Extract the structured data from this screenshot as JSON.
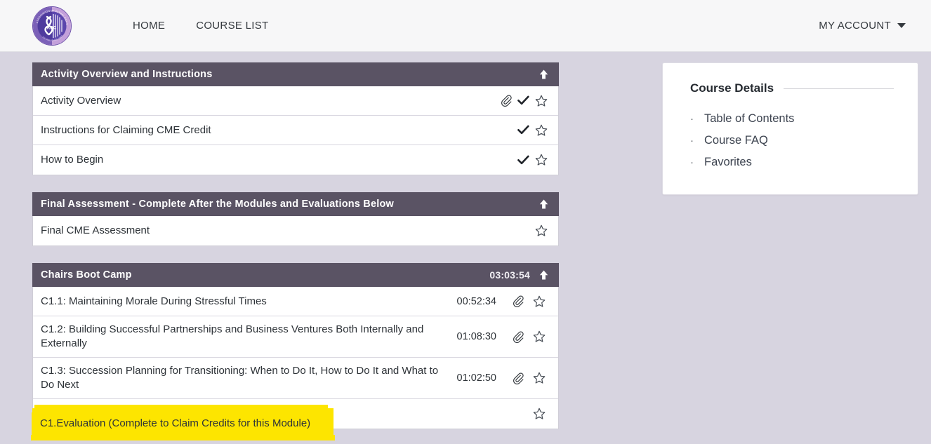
{
  "navbar": {
    "logo_alt": "Association of Pathology Chairs",
    "logo_center_text": "APC",
    "links": [
      {
        "label": "HOME",
        "name": "nav-link-home"
      },
      {
        "label": "COURSE LIST",
        "name": "nav-link-course-list"
      }
    ],
    "account_label": "MY ACCOUNT"
  },
  "sections": [
    {
      "title": "Activity Overview and Instructions",
      "duration": "",
      "collapse_icon": "arrow-up-icon",
      "rows": [
        {
          "title": "Activity Overview",
          "time": "",
          "attachment": true,
          "complete": true,
          "favorite": false
        },
        {
          "title": "Instructions for Claiming CME Credit",
          "time": "",
          "attachment": false,
          "complete": true,
          "favorite": false
        },
        {
          "title": "How to Begin",
          "time": "",
          "attachment": false,
          "complete": true,
          "favorite": false
        }
      ]
    },
    {
      "title": "Final Assessment - Complete After the Modules and Evaluations Below",
      "duration": "",
      "collapse_icon": "arrow-up-icon",
      "rows": [
        {
          "title": "Final CME Assessment",
          "time": "",
          "attachment": false,
          "complete": false,
          "favorite": false
        }
      ]
    },
    {
      "title": "Chairs Boot Camp",
      "duration": "03:03:54",
      "collapse_icon": "arrow-up-icon",
      "rows": [
        {
          "title": "C1.1: Maintaining Morale During Stressful Times",
          "time": "00:52:34",
          "attachment": true,
          "complete": false,
          "favorite": false
        },
        {
          "title": "C1.2: Building Successful Partnerships and Business Ventures Both Internally and Externally",
          "time": "01:08:30",
          "attachment": true,
          "complete": false,
          "favorite": false
        },
        {
          "title": "C1.3: Succession Planning for Transitioning: When to Do It, How to Do It and What to Do Next",
          "time": "01:02:50",
          "attachment": true,
          "complete": false,
          "favorite": false
        },
        {
          "title": "C1.Evaluation (Complete to Claim Credits for this Module)",
          "time": "",
          "attachment": false,
          "complete": false,
          "favorite": false,
          "highlighted": true
        }
      ]
    }
  ],
  "sidebar": {
    "card_title": "Course Details",
    "links": [
      {
        "label": "Table of Contents"
      },
      {
        "label": "Course FAQ"
      },
      {
        "label": "Favorites"
      }
    ]
  },
  "annotation": {
    "highlight_text": "C1.Evaluation (Complete to Claim Credits for this Module)",
    "highlight_color": "#fde500"
  },
  "colors": {
    "section_header": "#5a5364",
    "page_background": "#d7d4e0",
    "navbar_background": "#f7f7f8",
    "highlight": "#fde500"
  }
}
